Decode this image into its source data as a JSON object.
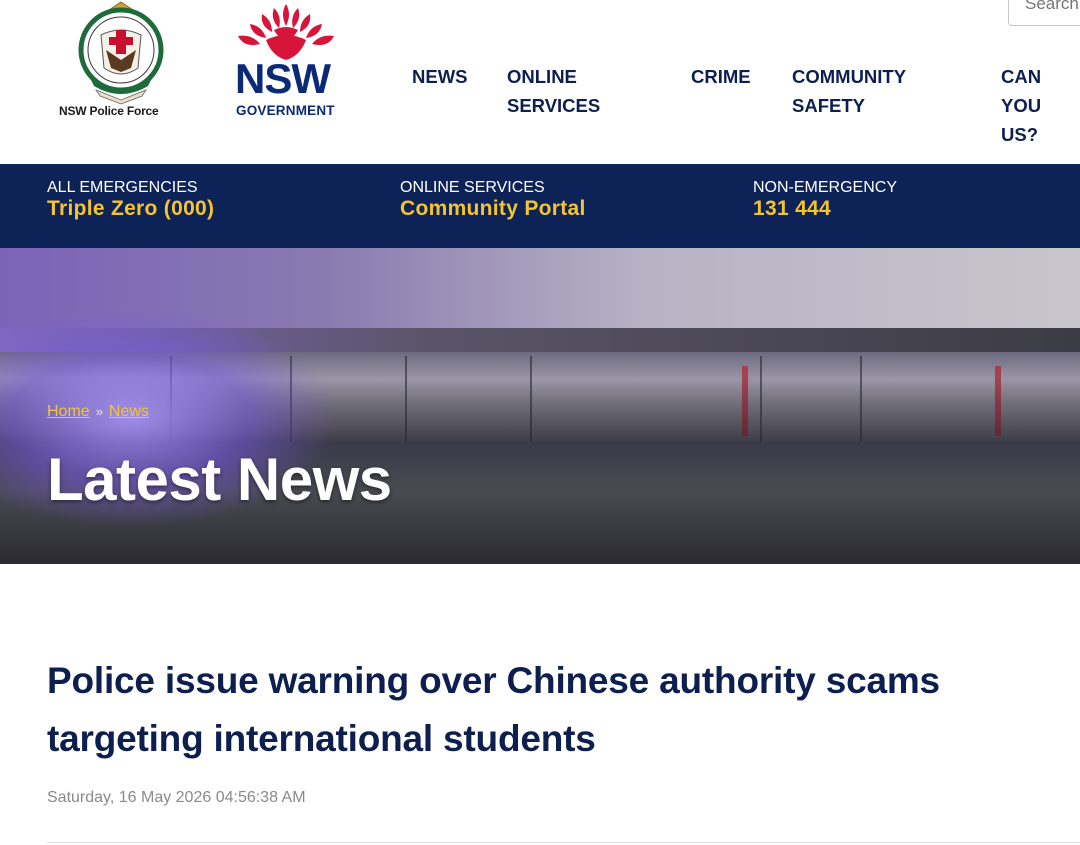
{
  "header": {
    "police_logo_text": "NSW Police Force",
    "nsw_logo_word": "NSW",
    "nsw_logo_sub": "GOVERNMENT",
    "search_placeholder": "Search",
    "nav": [
      {
        "label": "NEWS"
      },
      {
        "label": "ONLINE\nSERVICES"
      },
      {
        "label": "CRIME"
      },
      {
        "label": "COMMUNITY\nSAFETY"
      },
      {
        "label": "CAN YOU\nUS?"
      }
    ]
  },
  "emergency_bar": {
    "items": [
      {
        "label": "ALL EMERGENCIES",
        "value": "Triple Zero (000)"
      },
      {
        "label": "ONLINE SERVICES",
        "value": "Community Portal"
      },
      {
        "label": "NON-EMERGENCY",
        "value": "131 444"
      }
    ]
  },
  "hero": {
    "breadcrumb": [
      {
        "label": "Home"
      },
      {
        "label": "News"
      }
    ],
    "breadcrumb_separator": "»",
    "title": "Latest News"
  },
  "article": {
    "title": "Police issue warning over Chinese authority scams targeting international students",
    "date": "Saturday, 16 May 2026 04:56:38 AM"
  },
  "colors": {
    "navy": "#0d2257",
    "gold": "#f5c431",
    "text_dark": "#0d1f4f",
    "nsw_red": "#d7153a",
    "nsw_blue": "#0a2a78"
  }
}
